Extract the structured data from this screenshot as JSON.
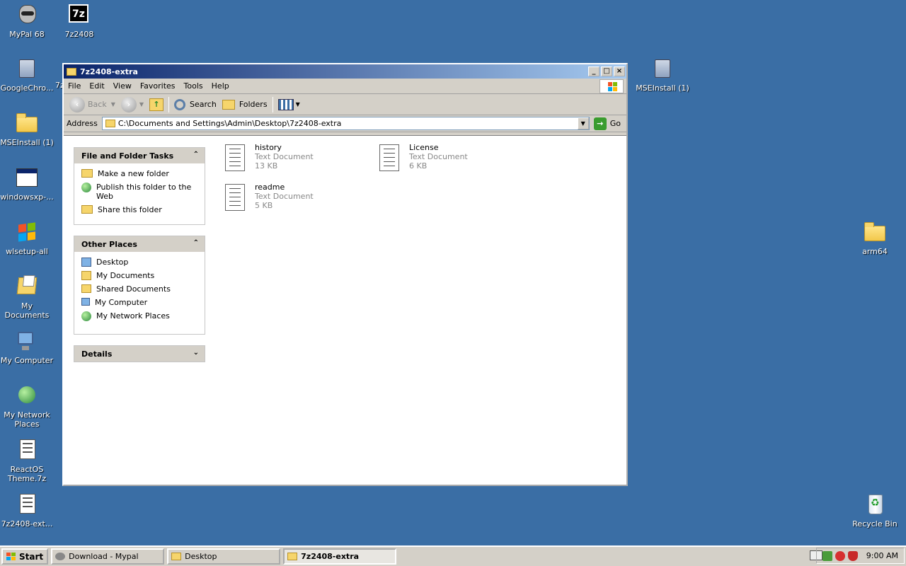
{
  "desktop": {
    "icons": [
      {
        "label": "MyPal 68",
        "icon": "raccoon-icon"
      },
      {
        "label": "7z2408",
        "icon": "7zip-icon"
      },
      {
        "label": "GoogleChro...",
        "icon": "setup-icon"
      },
      {
        "label": "MSEInstall (1)",
        "icon": "folder-zip-icon"
      },
      {
        "label": "windowsxp-...",
        "icon": "window-icon"
      },
      {
        "label": "wlsetup-all",
        "icon": "windows-logo-icon"
      },
      {
        "label": "My Documents",
        "icon": "my-documents-icon"
      },
      {
        "label": "My Computer",
        "icon": "computer-icon"
      },
      {
        "label": "My Network Places",
        "icon": "network-icon"
      },
      {
        "label": "ReactOS Theme.7z",
        "icon": "archive-icon"
      },
      {
        "label": "7z2408-ext...",
        "icon": "archive-icon"
      },
      {
        "label": "MSEInstall (1)",
        "icon": "installer-icon"
      },
      {
        "label": "arm64",
        "icon": "folder-icon"
      },
      {
        "label": "Recycle Bin",
        "icon": "recycle-bin-icon"
      },
      {
        "label": "7z",
        "icon": "partial-label"
      }
    ]
  },
  "window": {
    "title": "7z2408-extra",
    "menu": [
      "File",
      "Edit",
      "View",
      "Favorites",
      "Tools",
      "Help"
    ],
    "toolbar": {
      "back": "Back",
      "search": "Search",
      "folders": "Folders"
    },
    "address": {
      "label": "Address",
      "path": "C:\\Documents and Settings\\Admin\\Desktop\\7z2408-extra",
      "go": "Go"
    },
    "tasks_panel": {
      "title": "File and Folder Tasks",
      "items": [
        "Make a new folder",
        "Publish this folder to the Web",
        "Share this folder"
      ]
    },
    "places_panel": {
      "title": "Other Places",
      "items": [
        "Desktop",
        "My Documents",
        "Shared Documents",
        "My Computer",
        "My Network Places"
      ]
    },
    "details_panel": {
      "title": "Details"
    },
    "files": [
      {
        "name": "history",
        "type": "Text Document",
        "size": "13 KB"
      },
      {
        "name": "License",
        "type": "Text Document",
        "size": "6 KB"
      },
      {
        "name": "readme",
        "type": "Text Document",
        "size": "5 KB"
      }
    ]
  },
  "taskbar": {
    "start": "Start",
    "buttons": [
      {
        "label": "Download - Mypal"
      },
      {
        "label": "Desktop"
      },
      {
        "label": "7z2408-extra"
      }
    ],
    "clock": "9:00 AM"
  },
  "colors": {
    "desktop": "#3a6ea5",
    "titlebar_start": "#0a246a",
    "titlebar_end": "#a6caf0",
    "chrome": "#d4d0c8"
  }
}
